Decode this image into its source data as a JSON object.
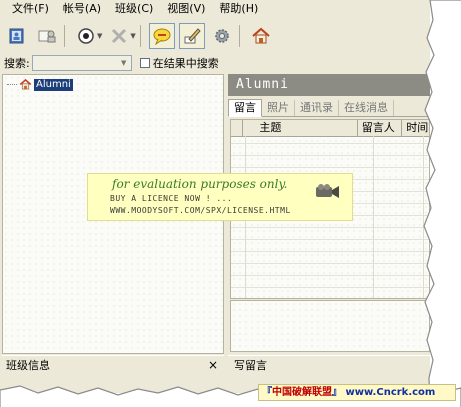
{
  "menubar": {
    "items": [
      "文件(F)",
      "帐号(A)",
      "班级(C)",
      "视图(V)",
      "帮助(H)"
    ]
  },
  "toolbar": {
    "buttons": [
      "address-book-icon",
      "contact-icon",
      "eye-icon",
      "delete-icon",
      "chat-icon",
      "edit-icon",
      "gear-icon",
      "home-icon"
    ]
  },
  "search": {
    "label": "搜索:",
    "value": "",
    "checkbox_label": "在结果中搜索"
  },
  "tree": {
    "root_label": "Alumni"
  },
  "left_footer": {
    "title": "班级信息",
    "close": "×"
  },
  "right_panel": {
    "header": "Alumni",
    "tabs": [
      "留言",
      "照片",
      "通讯录",
      "在线消息"
    ],
    "columns": [
      "主题",
      "留言人",
      "时间"
    ]
  },
  "right_footer": {
    "title": "写留言"
  },
  "watermark": {
    "line1": "for evaluation purposes only.",
    "line2": "BUY A LICENCE NOW ! ...",
    "line3": "WWW.MOODYSOFT.COM/SPX/LICENSE.HTML"
  },
  "credit": {
    "open": "『",
    "name": "中国破解联盟",
    "close": "』",
    "url": "www.Cncrk.com"
  },
  "colors": {
    "window_bg": "#ece9d8",
    "header_bg": "#8c8c84",
    "selection": "#1c3e7a",
    "watermark_bg": "#ffffc0"
  }
}
